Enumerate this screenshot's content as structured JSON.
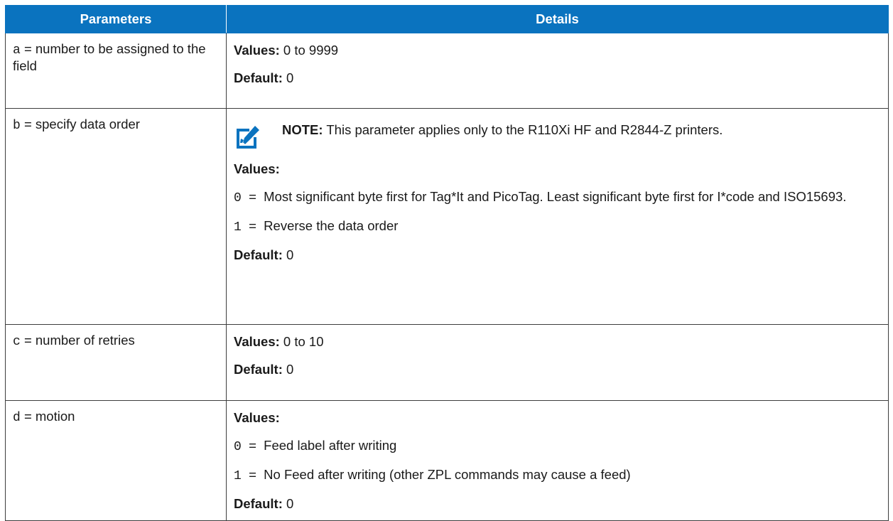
{
  "header": {
    "col_parameters": "Parameters",
    "col_details": "Details"
  },
  "rows": [
    {
      "param_code": "a",
      "param_desc": " = number to be assigned to the field",
      "values_label": "Values:",
      "values_text": " 0 to 9999",
      "default_label": "Default:",
      "default_value": " 0"
    },
    {
      "param_code": "b",
      "param_desc": " = specify data order",
      "note_label": "NOTE:",
      "note_text": " This parameter applies only to the R110Xi HF and R2844-Z printers.",
      "note_icon": "note-edit-icon",
      "values_label": "Values:",
      "options": [
        {
          "code": "0",
          "text": "  =  Most significant byte first for Tag*It and PicoTag. Least significant byte first for I*code and ISO15693."
        },
        {
          "code": "1",
          "text": "  =  Reverse the data order"
        }
      ],
      "default_label": "Default:",
      "default_value": " 0"
    },
    {
      "param_code": "c",
      "param_desc": " = number of retries",
      "values_label": "Values:",
      "values_text": " 0 to 10",
      "default_label": "Default:",
      "default_value": " 0"
    },
    {
      "param_code": "d",
      "param_desc": " = motion",
      "values_label": "Values:",
      "options": [
        {
          "code": "0",
          "text": "  =  Feed label after writing"
        },
        {
          "code": "1",
          "text": "  =  No Feed after writing (other ZPL commands may cause a feed)"
        }
      ],
      "default_label": "Default:",
      "default_value": " 0"
    }
  ],
  "colors": {
    "header_bg": "#0a73bf",
    "header_text": "#ffffff",
    "icon": "#0a73bf",
    "border": "#3d3d3d"
  }
}
